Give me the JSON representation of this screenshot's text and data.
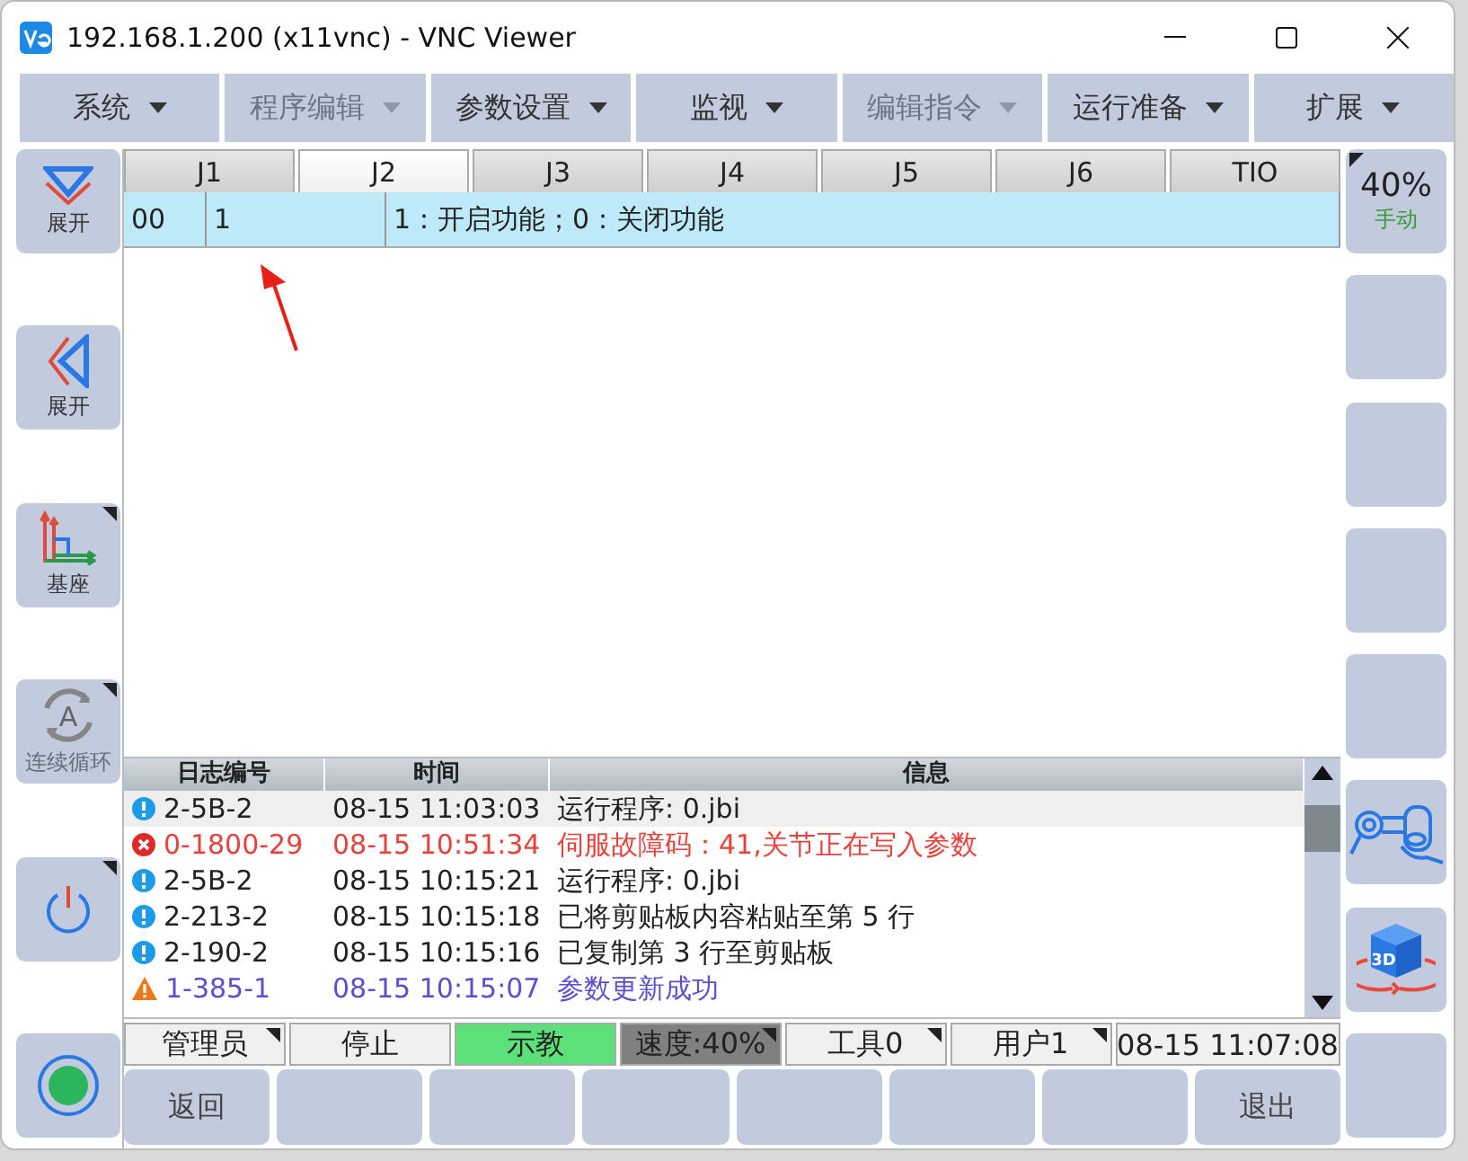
{
  "window": {
    "title": "192.168.1.200 (x11vnc) - VNC Viewer"
  },
  "menu": [
    {
      "label": "系统",
      "disabled": false
    },
    {
      "label": "程序编辑",
      "disabled": true
    },
    {
      "label": "参数设置",
      "disabled": false
    },
    {
      "label": "监视",
      "disabled": false
    },
    {
      "label": "编辑指令",
      "disabled": true
    },
    {
      "label": "运行准备",
      "disabled": false
    },
    {
      "label": "扩展",
      "disabled": false
    }
  ],
  "left_buttons": [
    {
      "kind": "expand-down",
      "label": "展开",
      "menu": false,
      "disabled": false
    },
    {
      "kind": "expand-left",
      "label": "展开",
      "menu": false,
      "disabled": false
    },
    {
      "kind": "axes",
      "label": "基座",
      "menu": true,
      "disabled": false
    },
    {
      "kind": "cycle",
      "label": "连续循环",
      "icon_text": "A",
      "menu": true,
      "disabled": true
    },
    {
      "kind": "power",
      "menu": true,
      "disabled": false
    },
    {
      "kind": "record",
      "menu": false,
      "disabled": false
    }
  ],
  "tabs": [
    {
      "label": "J1",
      "selected": false
    },
    {
      "label": "J2",
      "selected": true
    },
    {
      "label": "J3",
      "selected": false
    },
    {
      "label": "J4",
      "selected": false
    },
    {
      "label": "J5",
      "selected": false
    },
    {
      "label": "J6",
      "selected": false
    },
    {
      "label": "TIO",
      "selected": false
    }
  ],
  "table": {
    "rows": [
      {
        "selected": true,
        "cells": [
          "00",
          "1",
          "1：开启功能；0：关闭功能"
        ]
      }
    ]
  },
  "log": {
    "columns": [
      "日志编号",
      "时间",
      "信息"
    ],
    "rows": [
      {
        "kind": "info",
        "color": "#222222",
        "selected": true,
        "cells": [
          "2-5B-2",
          "08-15 11:03:03",
          "运行程序: 0.jbi"
        ]
      },
      {
        "kind": "error",
        "color": "#e8403a",
        "selected": false,
        "cells": [
          "0-1800-29",
          "08-15 10:51:34",
          "伺服故障码：41,关节正在写入参数"
        ]
      },
      {
        "kind": "info",
        "color": "#222222",
        "selected": false,
        "cells": [
          "2-5B-2",
          "08-15 10:15:21",
          "运行程序: 0.jbi"
        ]
      },
      {
        "kind": "info",
        "color": "#222222",
        "selected": false,
        "cells": [
          "2-213-2",
          "08-15 10:15:18",
          "已将剪贴板内容粘贴至第 5 行"
        ]
      },
      {
        "kind": "info",
        "color": "#222222",
        "selected": false,
        "cells": [
          "2-190-2",
          "08-15 10:15:16",
          "已复制第 3 行至剪贴板"
        ]
      },
      {
        "kind": "warning",
        "color": "#5a4fd0",
        "selected": false,
        "cells": [
          "1-385-1",
          "08-15 10:15:07",
          "参数更新成功"
        ]
      }
    ]
  },
  "status_bar": [
    {
      "label": "管理员",
      "color": "#f0f0f0",
      "menu": true
    },
    {
      "label": "停止",
      "color": "#f0f0f0",
      "menu": false
    },
    {
      "label": "示教",
      "color": "#5ce07a",
      "menu": false
    },
    {
      "label": "速度:40%",
      "color": "#808080",
      "menu": true
    },
    {
      "label": "工具0",
      "color": "#f0f0f0",
      "menu": true
    },
    {
      "label": "用户1",
      "color": "#f0f0f0",
      "menu": true
    },
    {
      "label": "08-15 11:07:08",
      "color": "#f0f0f0",
      "menu": false
    }
  ],
  "bottom_buttons": [
    {
      "kind": "text",
      "label": "返回"
    },
    {
      "kind": "blank"
    },
    {
      "kind": "blank"
    },
    {
      "kind": "blank"
    },
    {
      "kind": "blank"
    },
    {
      "kind": "blank"
    },
    {
      "kind": "blank"
    },
    {
      "kind": "text",
      "label": "退出"
    }
  ],
  "right_buttons": [
    {
      "kind": "speed",
      "value": "40%",
      "mode": "手动",
      "menu": true
    },
    {
      "kind": "blank"
    },
    {
      "kind": "blank"
    },
    {
      "kind": "blank"
    },
    {
      "kind": "blank"
    },
    {
      "kind": "robot"
    },
    {
      "kind": "view3d",
      "icon_text": "3D"
    },
    {
      "kind": "blank"
    }
  ]
}
